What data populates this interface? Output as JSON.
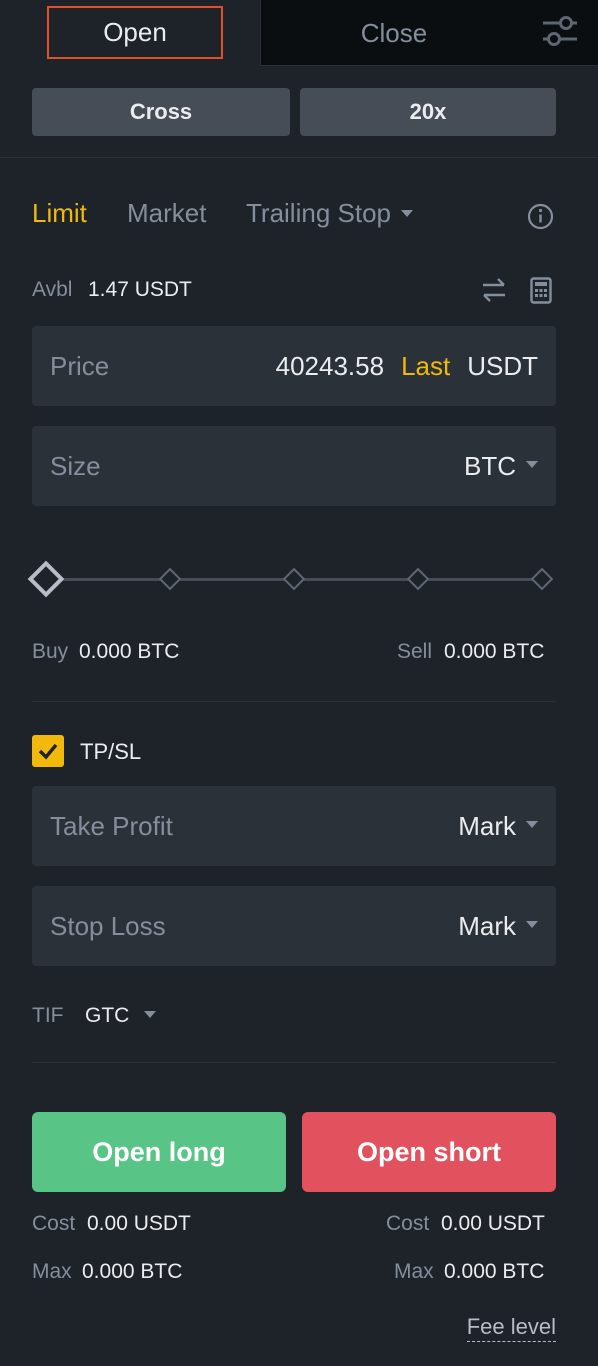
{
  "tabs": {
    "open": "Open",
    "close": "Close"
  },
  "margin": {
    "mode": "Cross",
    "leverage": "20x"
  },
  "order_types": {
    "limit": "Limit",
    "market": "Market",
    "trailing": "Trailing Stop"
  },
  "available": {
    "label": "Avbl",
    "value": "1.47 USDT"
  },
  "price": {
    "placeholder": "Price",
    "value": "40243.58",
    "last": "Last",
    "unit": "USDT"
  },
  "size": {
    "placeholder": "Size",
    "unit": "BTC"
  },
  "buy": {
    "label": "Buy",
    "value": "0.000 BTC"
  },
  "sell": {
    "label": "Sell",
    "value": "0.000 BTC"
  },
  "tpsl": {
    "label": "TP/SL",
    "checked": true
  },
  "take_profit": {
    "placeholder": "Take Profit",
    "trigger": "Mark"
  },
  "stop_loss": {
    "placeholder": "Stop Loss",
    "trigger": "Mark"
  },
  "tif": {
    "label": "TIF",
    "value": "GTC"
  },
  "actions": {
    "long": "Open long",
    "short": "Open short"
  },
  "long_cost": {
    "label": "Cost",
    "value": "0.00 USDT"
  },
  "short_cost": {
    "label": "Cost",
    "value": "0.00 USDT"
  },
  "long_max": {
    "label": "Max",
    "value": "0.000 BTC"
  },
  "short_max": {
    "label": "Max",
    "value": "0.000 BTC"
  },
  "fee_level": "Fee level",
  "colors": {
    "accent": "#f0b90b",
    "long": "#58c587",
    "short": "#e2525e",
    "bg": "#1e2329",
    "field": "#2b3139"
  }
}
